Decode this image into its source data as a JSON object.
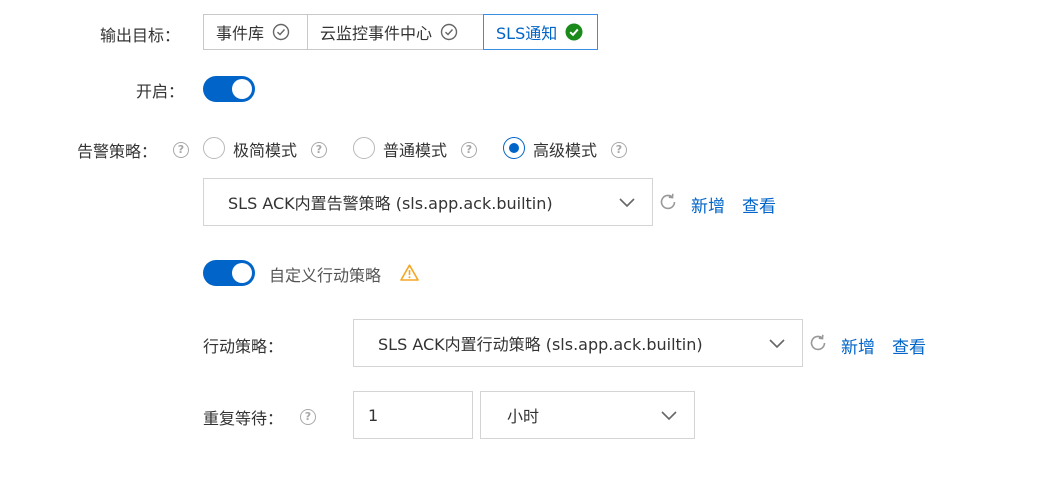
{
  "output_target": {
    "label": "输出目标：",
    "options": [
      {
        "label": "事件库",
        "icon": "check-circle-outline-icon",
        "selected": false
      },
      {
        "label": "云监控事件中心",
        "icon": "check-circle-outline-icon",
        "selected": false
      },
      {
        "label": "SLS通知",
        "icon": "check-circle-filled-icon",
        "selected": true
      }
    ]
  },
  "enable": {
    "label": "开启：",
    "on": true
  },
  "alert_policy": {
    "label": "告警策略：",
    "modes": [
      {
        "label": "极简模式",
        "selected": false
      },
      {
        "label": "普通模式",
        "selected": false
      },
      {
        "label": "高级模式",
        "selected": true
      }
    ],
    "select_value": "SLS ACK内置告警策略 (sls.app.ack.builtin)",
    "add_label": "新增",
    "view_label": "查看"
  },
  "custom_action": {
    "toggle_on": true,
    "label": "自定义行动策略",
    "warning_icon": "warning-icon"
  },
  "action_policy": {
    "label": "行动策略：",
    "select_value": "SLS ACK内置行动策略 (sls.app.ack.builtin)",
    "add_label": "新增",
    "view_label": "查看"
  },
  "repeat_wait": {
    "label": "重复等待：",
    "value": "1",
    "unit": "小时"
  },
  "colors": {
    "accent": "#0064c8",
    "success": "#1a8a1a",
    "warning": "#f5a623"
  }
}
